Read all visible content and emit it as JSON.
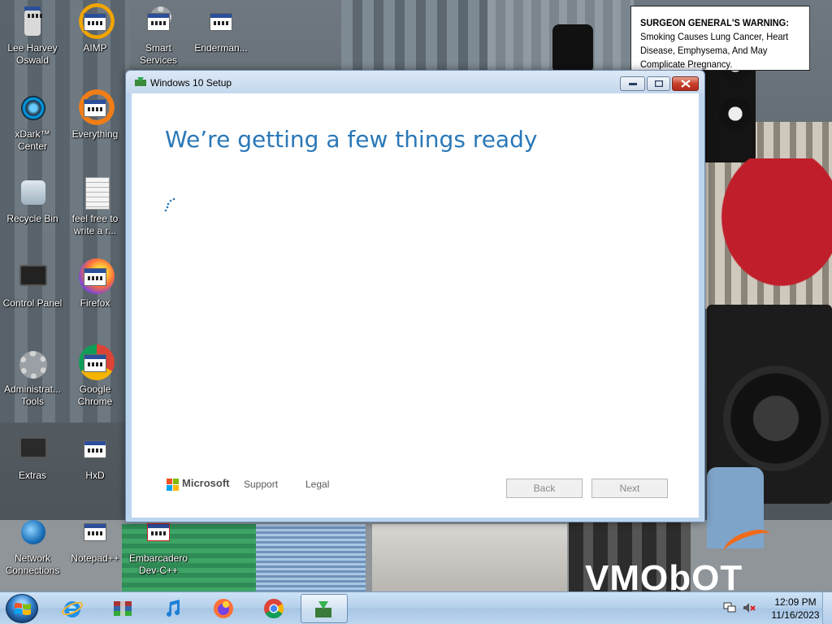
{
  "desktop": {
    "warning_sticker": {
      "title": "SURGEON GENERAL'S WARNING:",
      "text": "Smoking Causes Lung Cancer, Heart Disease, Emphysema, And May Complicate Pregnancy."
    },
    "wallpaper_text": "VMObOT",
    "icons": [
      {
        "label": "Lee Harvey Oswald",
        "icon": "person-icon"
      },
      {
        "label": "AIMP",
        "icon": "aimp-icon"
      },
      {
        "label": "Smart Services",
        "icon": "smart-services-icon"
      },
      {
        "label": "Enderman...",
        "icon": "enderman-shortcut-icon"
      },
      {
        "label": "xDark™ Center",
        "icon": "xdark-center-icon"
      },
      {
        "label": "Everything",
        "icon": "everything-search-icon"
      },
      {
        "label": "Recycle Bin",
        "icon": "recycle-bin-icon"
      },
      {
        "label": "feel free to write a r...",
        "icon": "text-document-icon"
      },
      {
        "label": "Control Panel",
        "icon": "control-panel-icon"
      },
      {
        "label": "Firefox",
        "icon": "firefox-icon"
      },
      {
        "label": "Administrat... Tools",
        "icon": "administrative-tools-icon"
      },
      {
        "label": "Google Chrome",
        "icon": "chrome-icon"
      },
      {
        "label": "Extras",
        "icon": "extras-folder-icon"
      },
      {
        "label": "HxD",
        "icon": "hxd-icon"
      },
      {
        "label": "Network Connections",
        "icon": "network-connections-icon"
      },
      {
        "label": "Notepad++",
        "icon": "notepad-plus-plus-icon"
      },
      {
        "label": "Embarcadero Dev-C++",
        "icon": "devcpp-icon"
      }
    ]
  },
  "window": {
    "title": "Windows 10 Setup",
    "heading": "We’re getting a few things ready",
    "footer": {
      "brand": "Microsoft",
      "support": "Support",
      "legal": "Legal"
    },
    "buttons": {
      "back": "Back",
      "next": "Next"
    },
    "colors": {
      "heading": "#2a78b8",
      "client_bg": "#ffffff",
      "frame": "#bcd5ee"
    }
  },
  "taskbar": {
    "pinned": [
      {
        "name": "internet-explorer-icon"
      },
      {
        "name": "archive-app-icon"
      },
      {
        "name": "itunes-icon"
      },
      {
        "name": "firefox-icon"
      },
      {
        "name": "chrome-icon"
      },
      {
        "name": "windows-setup-icon"
      }
    ],
    "clock": {
      "time": "12:09 PM",
      "date": "11/16/2023"
    }
  }
}
